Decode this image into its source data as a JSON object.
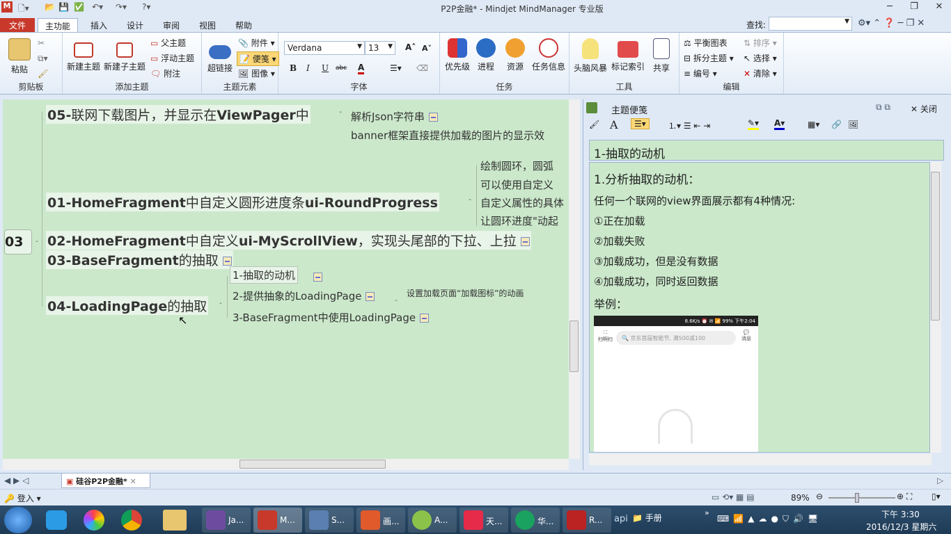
{
  "window": {
    "title": "P2P金融* - Mindjet MindManager 专业版"
  },
  "search": {
    "label": "查找:",
    "value": ""
  },
  "tabs": [
    "文件",
    "主功能",
    "插入",
    "设计",
    "审阅",
    "视图",
    "帮助"
  ],
  "ribbon": {
    "clipboard": {
      "paste": "粘贴",
      "group": "剪贴板"
    },
    "add_topic": {
      "new_topic": "新建主题",
      "new_subtopic": "新建子主题",
      "parent": "父主题",
      "floating": "浮动主题",
      "callout": "附注",
      "group": "添加主题"
    },
    "elements": {
      "hyperlink": "超链接",
      "attachment": "附件",
      "notes": "便笺",
      "image": "图像",
      "group": "主题元素"
    },
    "font": {
      "family": "Verdana",
      "size": "13",
      "group": "字体",
      "bold": "B",
      "italic": "I",
      "underline": "U",
      "strike": "abc",
      "grow": "A",
      "shrink": "A",
      "color": "A"
    },
    "task": {
      "priority": "优先级",
      "progress": "进程",
      "resource": "资源",
      "task_info": "任务信息",
      "group": "任务"
    },
    "tools": {
      "brainstorm": "头脑风暴",
      "mark_index": "标记索引",
      "share": "共享",
      "group": "工具"
    },
    "edit": {
      "balance": "平衡图表",
      "split": "拆分主题",
      "number": "编号",
      "sort": "排序",
      "select": "选择",
      "clear": "清除",
      "group": "编辑"
    }
  },
  "map": {
    "root": "03",
    "topics": [
      {
        "en": "05-",
        "cn": "联网下载图片，并显示在",
        "en2": "ViewPager",
        "cn2": "中"
      },
      {
        "en": "01-HomeFragment",
        "cn": "中自定义圆形进度条",
        "en2": "ui-RoundProgress",
        "cn2": ""
      },
      {
        "en": "02-HomeFragment",
        "cn": "中自定义",
        "en2": "ui-MyScrollView",
        "cn2": "，实现头尾部的下拉、上拉"
      },
      {
        "en": "03-BaseFragment",
        "cn": "的抽取",
        "en2": "",
        "cn2": ""
      },
      {
        "en": "04-LoadingPage",
        "cn": "的抽取",
        "en2": "",
        "cn2": ""
      }
    ],
    "sub05": [
      "解析Json字符串",
      "banner框架直接提供加载的图片的显示效"
    ],
    "sub01": [
      "绘制圆环，圆弧",
      "可以使用自定义",
      "自定义属性的具体",
      "让圆环进度\"动起"
    ],
    "sub04": [
      "1-抽取的动机",
      "2-提供抽象的LoadingPage",
      "3-BaseFragment中使用LoadingPage"
    ],
    "sub04_2": "设置加载页面“加载图标”的动画"
  },
  "notes_panel": {
    "title": "主题便笺",
    "close": "关闭",
    "topic_title": "1-抽取的动机",
    "lines": [
      "1.分析抽取的动机：",
      "任何一个联网的view界面展示都有4种情况:",
      "①正在加载",
      "②加载失败",
      "③加载成功，但是没有数据",
      "④加载成功，同时返回数据",
      "举例："
    ],
    "phone": {
      "status": "8.6K/s ⏰ ✉ 📶 99% 下午2:04",
      "scan": "扫啊扫",
      "search_placeholder": "京东首届智能节, 满500减100",
      "msg": "消息"
    }
  },
  "sheet_tab": "硅谷P2P金融*",
  "status": {
    "login": "登入",
    "zoom": "89%"
  },
  "taskbar": {
    "items": [
      "Ja...",
      "M...",
      "S...",
      "画...",
      "A...",
      "天...",
      "华...",
      "R..."
    ],
    "tray_text": "api",
    "folder": "手册",
    "time": "下午 3:30",
    "date": "2016/12/3 星期六"
  }
}
